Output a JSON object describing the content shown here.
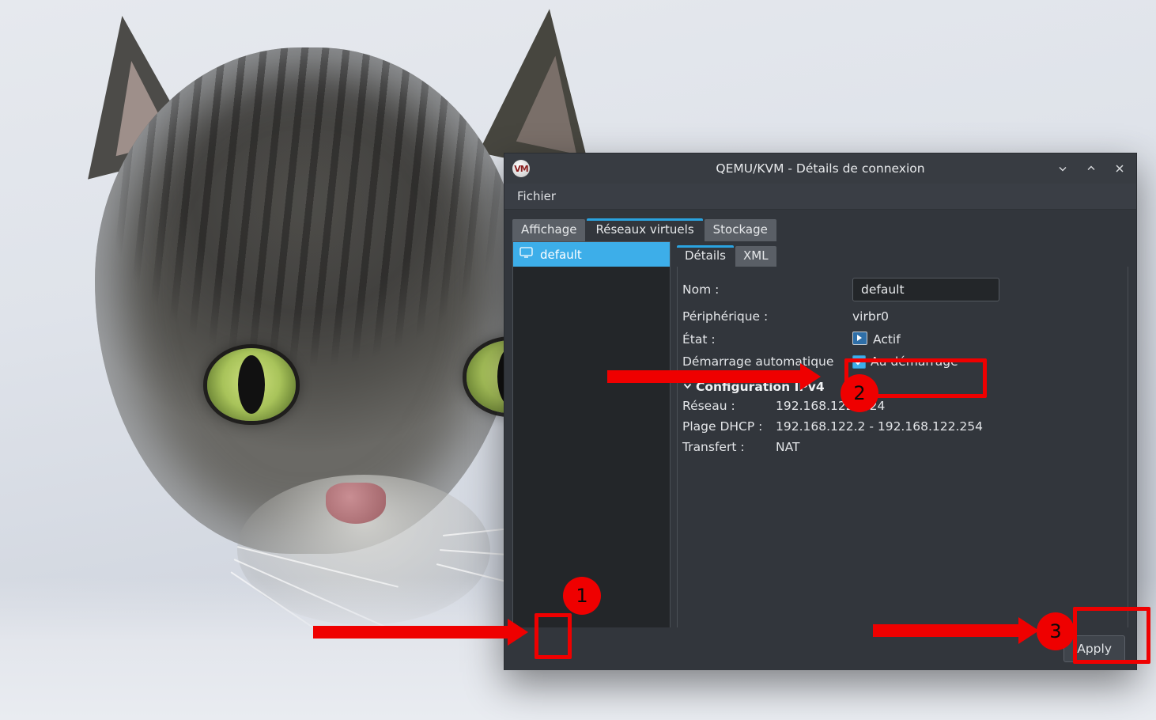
{
  "window": {
    "title": "QEMU/KVM - Détails de connexion",
    "logo_text": "VM",
    "controls": {
      "minimize": "minimize-icon",
      "maximize": "maximize-icon",
      "close": "close-icon"
    }
  },
  "menubar": {
    "items": [
      "Fichier"
    ]
  },
  "top_tabs": [
    {
      "label": "Affichage",
      "active": false
    },
    {
      "label": "Réseaux virtuels",
      "active": true
    },
    {
      "label": "Stockage",
      "active": false
    }
  ],
  "network_list": {
    "items": [
      {
        "label": "default",
        "icon": "monitor-icon",
        "selected": true
      }
    ]
  },
  "list_toolbar": [
    {
      "name": "add-network-button",
      "icon": "plus-icon",
      "label": "+"
    },
    {
      "name": "start-network-button",
      "icon": "play-icon",
      "label": "▶"
    },
    {
      "name": "stop-network-button",
      "icon": "stop-icon",
      "label": "◉"
    },
    {
      "name": "delete-network-button",
      "icon": "trash-icon",
      "label": "🗑"
    }
  ],
  "sub_tabs": [
    {
      "label": "Détails",
      "active": true
    },
    {
      "label": "XML",
      "active": false
    }
  ],
  "details": {
    "name_label": "Nom :",
    "name_value": "default",
    "device_label": "Périphérique :",
    "device_value": "virbr0",
    "state_label": "État :",
    "state_value": "Actif",
    "state_icon": "active-monitor-icon",
    "autostart_label": "Démarrage automatique",
    "autostart_checkbox_label": "Au démarrage",
    "autostart_checked": true,
    "ipv4_section_title": "Configuration IPv4",
    "ipv4_section_expanded": true,
    "network_label": "Réseau :",
    "network_value": "192.168.122.0/24",
    "dhcp_label": "Plage DHCP :",
    "dhcp_value": "192.168.122.2 - 192.168.122.254",
    "forward_label": "Transfert :",
    "forward_value": "NAT"
  },
  "footer": {
    "apply_label": "Apply"
  },
  "annotations": {
    "badges": [
      {
        "number": "1"
      },
      {
        "number": "2"
      },
      {
        "number": "3"
      }
    ],
    "accent_color": "#ef0000"
  }
}
